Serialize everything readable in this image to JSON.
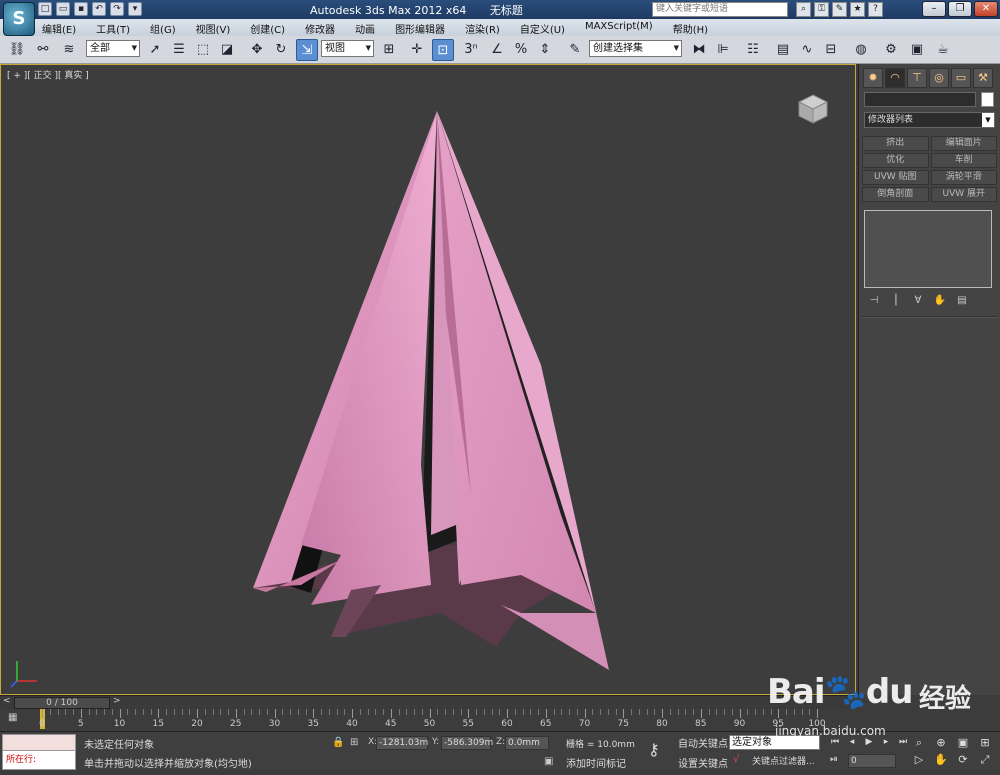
{
  "title_bar": {
    "app_title": "Autodesk 3ds Max  2012 x64",
    "doc_title": "无标题",
    "search_placeholder": "键入关键字或短语",
    "logo": "S"
  },
  "menu": {
    "items": [
      "编辑(E)",
      "工具(T)",
      "组(G)",
      "视图(V)",
      "创建(C)",
      "修改器",
      "动画",
      "图形编辑器",
      "渲染(R)",
      "自定义(U)",
      "MAXScript(M)",
      "帮助(H)"
    ]
  },
  "toolbar": {
    "selection_filter": "全部",
    "reference_coord": "视图",
    "named_selection": "创建选择集"
  },
  "viewport": {
    "label": "[ + ][ 正交 ][ 真实 ]",
    "object_color": "#e79bc4"
  },
  "command_panel": {
    "tab_icons": [
      "create-icon",
      "modify-icon",
      "hierarchy-icon",
      "motion-icon",
      "display-icon",
      "utilities-icon"
    ],
    "modifier_list": "修改器列表",
    "modifier_buttons": [
      "挤出",
      "编辑面片",
      "优化",
      "车削",
      "UVW 贴图",
      "涡轮平滑",
      "倒角剖面",
      "UVW 展开"
    ]
  },
  "time_slider": {
    "frame_display": "0 / 100",
    "prev_label": "<",
    "next_label": ">"
  },
  "ruler": {
    "labels": [
      "0",
      "5",
      "10",
      "15",
      "20",
      "25",
      "30",
      "35",
      "40",
      "45",
      "50",
      "55",
      "60",
      "65",
      "70",
      "75",
      "80",
      "85",
      "90",
      "95",
      "100"
    ]
  },
  "status": {
    "maxscript_label": "所在行:",
    "selection_status": "未选定任何对象",
    "prompt": "单击并拖动以选择并缩放对象(均匀地)",
    "x_label": "X:",
    "x_value": "-1281.03m",
    "y_label": "Y:",
    "y_value": "-586.309m",
    "z_label": "Z:",
    "z_value": "0.0mm",
    "grid": "栅格 = 10.0mm",
    "add_time_tag": "添加时间标记",
    "auto_key": "自动关键点",
    "set_key": "设置关键点",
    "selection_set": "选定对象",
    "key_filters": "关键点过滤器...",
    "current_frame": "0"
  },
  "watermark": {
    "brand": "Bai",
    "brand2": "du",
    "cn": "经验",
    "site": "jingyan.baidu.com"
  }
}
